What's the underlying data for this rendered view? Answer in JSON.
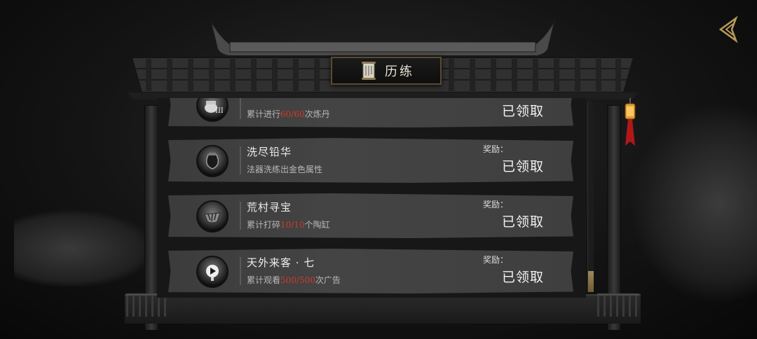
{
  "window": {
    "title": "历练"
  },
  "tasks": [
    {
      "name": "",
      "desc_prefix": "累计进行",
      "progress": "60/60",
      "desc_suffix": "次炼丹",
      "reward_label": "",
      "status": "已领取",
      "icon": "cauldron-icon"
    },
    {
      "name": "洗尽铅华",
      "desc_prefix": "法器洗练出金色属性",
      "progress": "",
      "desc_suffix": "",
      "reward_label": "奖励：",
      "status": "已领取",
      "icon": "urn-icon"
    },
    {
      "name": "荒村寻宝",
      "desc_prefix": "累计打碎",
      "progress": "10/10",
      "desc_suffix": "个陶缸",
      "reward_label": "奖励：",
      "status": "已领取",
      "icon": "broken-pot-icon"
    },
    {
      "name": "天外来客 · 七",
      "desc_prefix": "累计观看",
      "progress": "500/500",
      "desc_suffix": "次广告",
      "reward_label": "奖励：",
      "status": "已领取",
      "icon": "video-play-icon"
    }
  ],
  "scroll": {
    "position_fraction": 1.0
  },
  "colors": {
    "progress_highlight": "#d03a2a",
    "plaque_border": "#5a4a30"
  }
}
